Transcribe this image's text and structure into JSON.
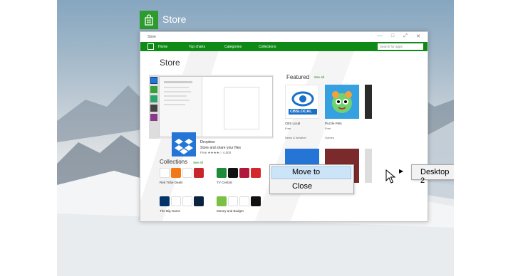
{
  "app_label": "Store",
  "window": {
    "title": "Store",
    "controls": [
      "—",
      "□",
      "⤢",
      "✕"
    ]
  },
  "navbar": {
    "items": [
      "Home",
      "Top charts",
      "Categories",
      "Collections"
    ],
    "search_placeholder": "Search for apps"
  },
  "page_title": "Store",
  "hero": {
    "name": "Dropbox",
    "description": "Store and share your files",
    "meta": "Free ★★★★☆ 4,500"
  },
  "featured": {
    "title": "Featured",
    "see_all": "See all",
    "apps": [
      {
        "name": "CBS Local",
        "price": "Free",
        "category": "News & Weather",
        "tile_text": "CBSLOCAL",
        "color": "#1a6fc7"
      },
      {
        "name": "Puzzle Pets",
        "price": "Free",
        "category": "Games",
        "color": "#35a1e0"
      }
    ]
  },
  "collections": {
    "title": "Collections",
    "see_all": "See all",
    "groups": [
      {
        "name": "Red Tribe Deals"
      },
      {
        "name": "TV Central"
      },
      {
        "name": "The Big Game"
      },
      {
        "name": "Money and Budget"
      }
    ]
  },
  "context_menu": {
    "items": [
      "Move to",
      "Close"
    ],
    "submenu": [
      "Desktop 2"
    ]
  },
  "colors": {
    "store_green": "#0f8a17",
    "dropbox_blue": "#2475d6",
    "menu_highlight": "#cce4f7"
  }
}
